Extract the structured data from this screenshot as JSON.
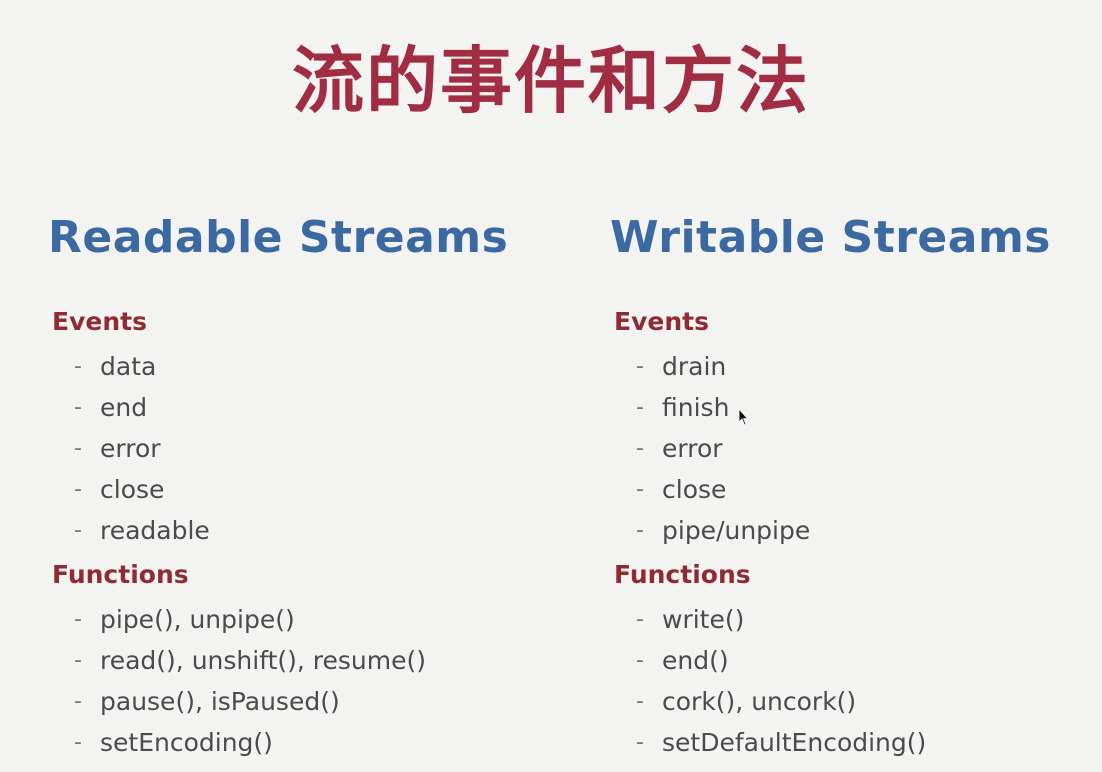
{
  "title": "流的事件和方法",
  "columns": [
    {
      "heading": "Readable Streams",
      "events_label": "Events",
      "events": [
        "data",
        "end",
        "error",
        "close",
        "readable"
      ],
      "functions_label": "Functions",
      "functions": [
        "pipe(), unpipe()",
        "read(), unshift(), resume()",
        "pause(), isPaused()",
        "setEncoding()"
      ]
    },
    {
      "heading": "Writable Streams",
      "events_label": "Events",
      "events": [
        "drain",
        "finish",
        "error",
        "close",
        "pipe/unpipe"
      ],
      "functions_label": "Functions",
      "functions": [
        "write()",
        "end()",
        "cork(), uncork()",
        "setDefaultEncoding()"
      ]
    }
  ],
  "colors": {
    "title": "#a12d42",
    "heading": "#3b6aa3",
    "section": "#8e2b33",
    "text": "#4b4b4b",
    "background": "#f3f3f2"
  }
}
